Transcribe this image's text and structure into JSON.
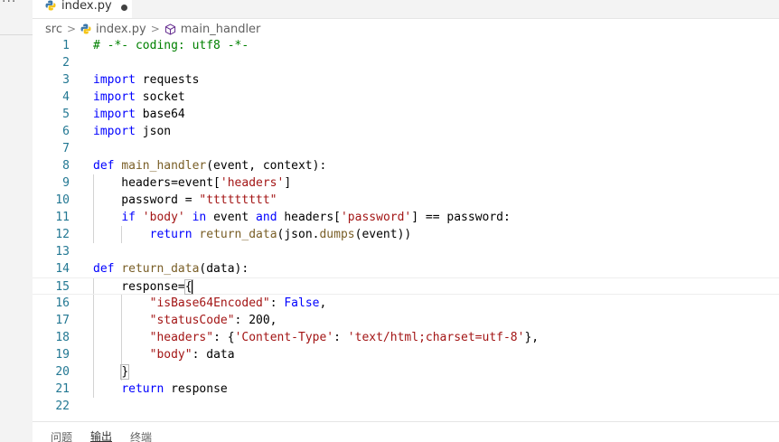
{
  "tab": {
    "label": "index.py",
    "dirty": true
  },
  "breadcrumb": {
    "folder": "src",
    "file": "index.py",
    "symbol": "main_handler"
  },
  "editor": {
    "lines": [
      {
        "n": "1",
        "html": "<span class=\"cm\"># -*- coding: utf8 -*-</span>"
      },
      {
        "n": "2",
        "html": ""
      },
      {
        "n": "3",
        "html": "<span class=\"kw\">import</span> requests"
      },
      {
        "n": "4",
        "html": "<span class=\"kw\">import</span> socket"
      },
      {
        "n": "5",
        "html": "<span class=\"kw\">import</span> base64"
      },
      {
        "n": "6",
        "html": "<span class=\"kw\">import</span> json"
      },
      {
        "n": "7",
        "html": ""
      },
      {
        "n": "8",
        "html": "<span class=\"kw\">def</span> <span class=\"fn\">main_handler</span>(event, context):"
      },
      {
        "n": "9",
        "html": "    headers=event[<span class=\"str\">'headers'</span>]"
      },
      {
        "n": "10",
        "html": "    password = <span class=\"str\">\"ttttttttt\"</span>"
      },
      {
        "n": "11",
        "html": "    <span class=\"kw\">if</span> <span class=\"str\">'body'</span> <span class=\"kw\">in</span> event <span class=\"kw\">and</span> headers[<span class=\"str\">'password'</span>] == password:"
      },
      {
        "n": "12",
        "html": "        <span class=\"kw\">return</span> <span class=\"fn\">return_data</span>(json.<span class=\"fn\">dumps</span>(event))"
      },
      {
        "n": "13",
        "html": ""
      },
      {
        "n": "14",
        "html": "<span class=\"kw\">def</span> <span class=\"fn\">return_data</span>(data):"
      },
      {
        "n": "15",
        "html": "    response=<span class=\"bracket\">{</span><span class=\"cursor\"></span>"
      },
      {
        "n": "16",
        "html": "        <span class=\"str\">\"isBase64Encoded\"</span>: <span class=\"kw\">False</span>,"
      },
      {
        "n": "17",
        "html": "        <span class=\"str\">\"statusCode\"</span>: 200,"
      },
      {
        "n": "18",
        "html": "        <span class=\"str\">\"headers\"</span>: {<span class=\"str\">'Content-Type'</span>: <span class=\"str\">'text/html;charset=utf-8'</span>},"
      },
      {
        "n": "19",
        "html": "        <span class=\"str\">\"body\"</span>: data"
      },
      {
        "n": "20",
        "html": "    <span class=\"bracket\">}</span>"
      },
      {
        "n": "21",
        "html": "    <span class=\"kw\">return</span> response"
      },
      {
        "n": "22",
        "html": ""
      }
    ]
  },
  "panel": {
    "tabs": [
      "问题",
      "输出",
      "终端"
    ],
    "active": "输出"
  }
}
